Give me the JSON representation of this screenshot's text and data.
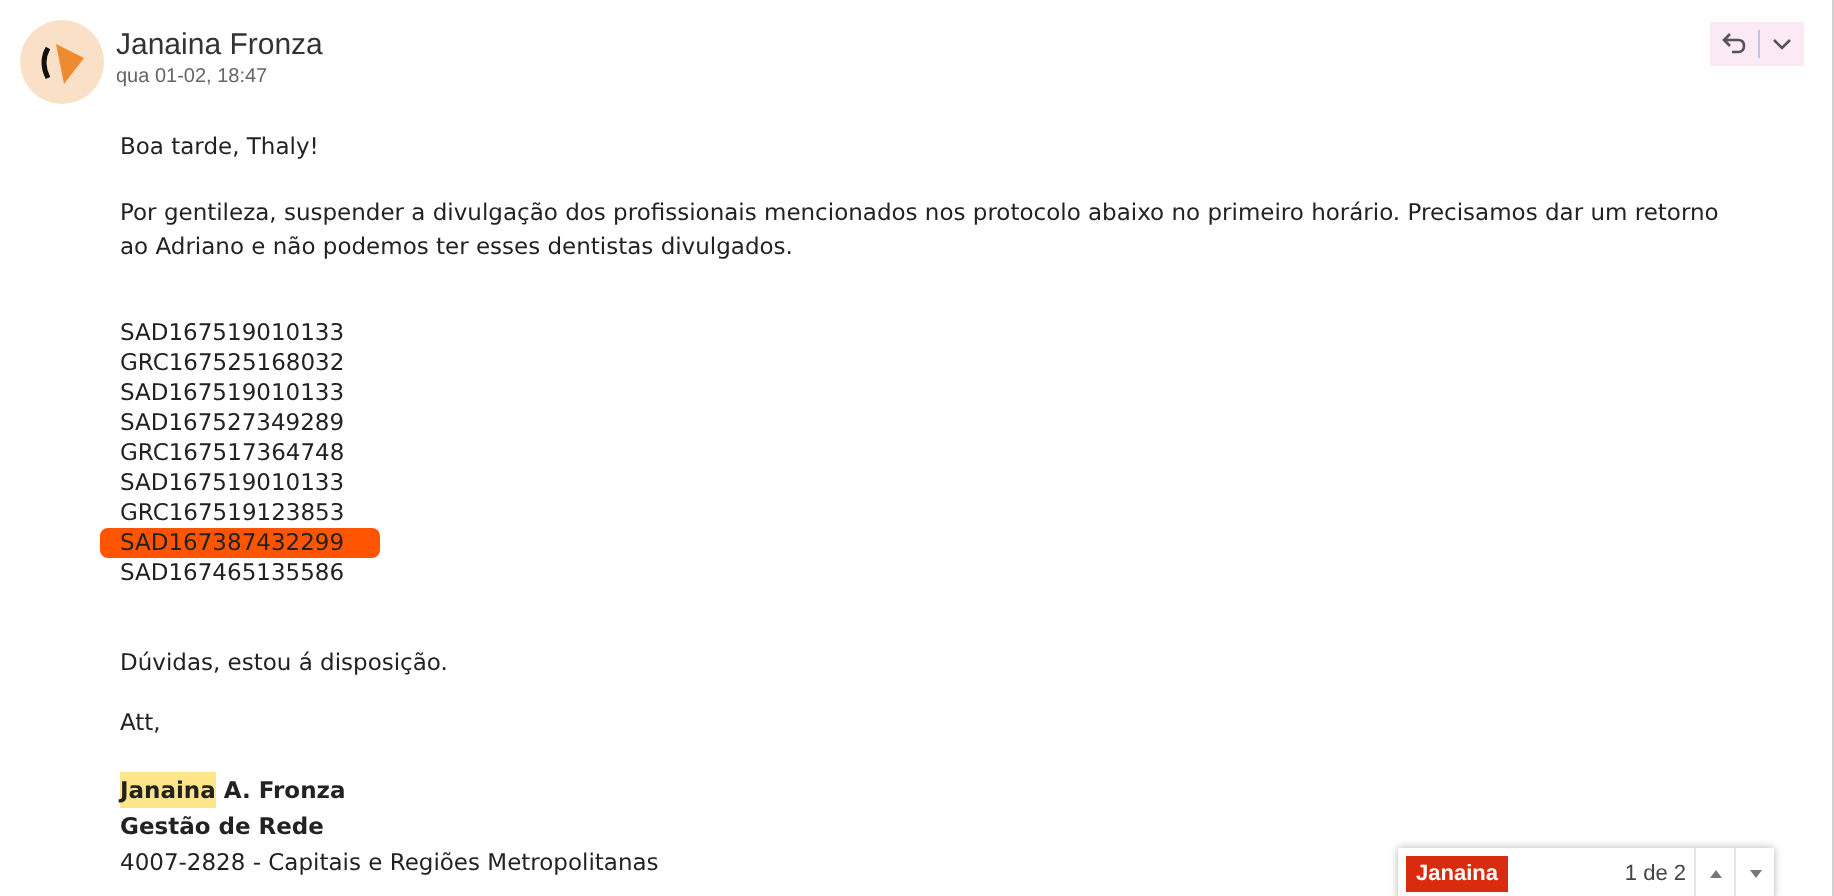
{
  "sender": {
    "name": "Janaina Fronza",
    "date": "qua 01-02, 18:47"
  },
  "body": {
    "greeting": "Boa tarde, Thaly!",
    "paragraph": "Por gentileza, suspender a divulgação dos profissionais mencionados nos protocolo abaixo no primeiro horário. Precisamos dar um retorno ao Adriano e não podemos ter esses dentistas divulgados.",
    "codes": [
      {
        "text": "SAD167519010133",
        "highlighted": false
      },
      {
        "text": "GRC167525168032",
        "highlighted": false
      },
      {
        "text": "SAD167519010133",
        "highlighted": false
      },
      {
        "text": "SAD167527349289",
        "highlighted": false
      },
      {
        "text": "GRC167517364748",
        "highlighted": false
      },
      {
        "text": "SAD167519010133",
        "highlighted": false
      },
      {
        "text": "GRC167519123853",
        "highlighted": false
      },
      {
        "text": "SAD167387432299",
        "highlighted": true
      },
      {
        "text": "SAD167465135586",
        "highlighted": false
      }
    ],
    "closing": "Dúvidas, estou á disposição.",
    "signoff": "Att,"
  },
  "signature": {
    "name_match": "Janaina",
    "name_rest": "A. Fronza",
    "department": "Gestão de Rede",
    "phone": "4007-2828 - Capitais e Regiões Metropolitanas"
  },
  "find_bar": {
    "term": "Janaina",
    "count": "1 de 2"
  }
}
